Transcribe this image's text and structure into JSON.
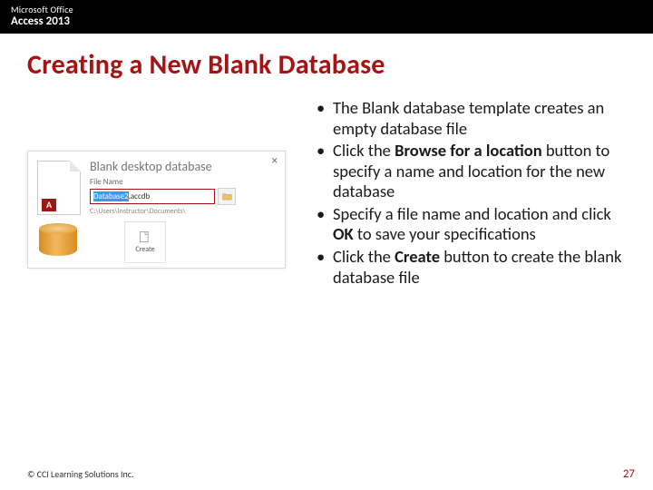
{
  "header": {
    "brand": "Microsoft Office",
    "product": "Access 2013"
  },
  "title": "Creating a New Blank Database",
  "figure": {
    "dialog_title": "Blank desktop database",
    "filename_label": "File Name",
    "filename_selected": "Database2",
    "filename_ext": ".accdb",
    "path": "C:\\Users\\Instructor\\Documents\\",
    "create_label": "Create",
    "close": "×",
    "doc_badge": "A"
  },
  "bullets": [
    {
      "pre": "The Blank database template creates an empty database file"
    },
    {
      "pre": "Click the ",
      "bold": "Browse for a location",
      "post": " button to specify a name and location for the new database"
    },
    {
      "pre": "Specify a file name and location and click ",
      "bold": "OK",
      "post": " to save your specifications"
    },
    {
      "pre": "Click the ",
      "bold": "Create",
      "post": " button to create the blank database file"
    }
  ],
  "footer": {
    "copyright": "© CCI Learning Solutions Inc.",
    "page": "27"
  }
}
